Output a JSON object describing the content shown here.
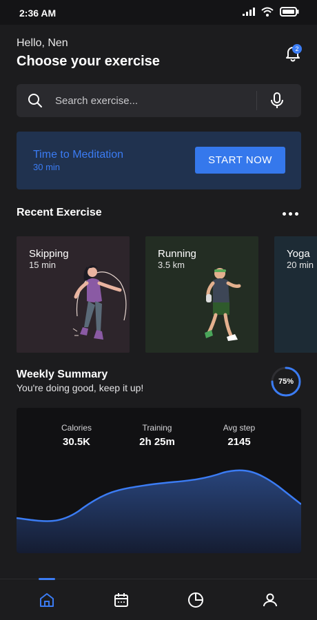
{
  "status_bar": {
    "time": "2:36 AM"
  },
  "header": {
    "greeting": "Hello, Nen",
    "title": "Choose your exercise",
    "notification_count": "2"
  },
  "search": {
    "placeholder": "Search exercise..."
  },
  "promo": {
    "title": "Time to Meditation",
    "duration": "30 min",
    "button_label": "START NOW"
  },
  "recent": {
    "title": "Recent Exercise",
    "cards": [
      {
        "title": "Skipping",
        "value": "15 min",
        "color": "#2d252b"
      },
      {
        "title": "Running",
        "value": "3.5 km",
        "color": "#232d23"
      },
      {
        "title": "Yoga",
        "value": "20 min",
        "color": "#1d2b35"
      }
    ]
  },
  "weekly": {
    "title": "Weekly Summary",
    "subtitle": "You're doing good, keep it up!",
    "progress_label": "75%",
    "progress": 0.75,
    "stats": [
      {
        "label": "Calories",
        "value": "30.5K"
      },
      {
        "label": "Training",
        "value": "2h 25m"
      },
      {
        "label": "Avg step",
        "value": "2145"
      }
    ]
  },
  "nav": {
    "items": [
      "home-icon",
      "calendar-icon",
      "chart-icon",
      "profile-icon"
    ],
    "active": "home-icon"
  },
  "colors": {
    "background": "#1c1c1e",
    "accent": "#3b7cf4",
    "surface": "#2a2a2e"
  }
}
